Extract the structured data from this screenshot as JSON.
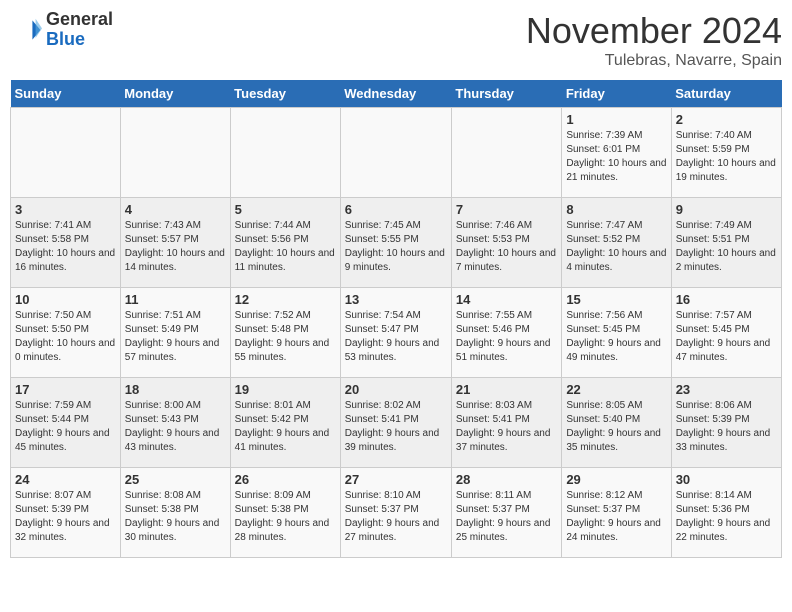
{
  "header": {
    "logo_general": "General",
    "logo_blue": "Blue",
    "month": "November 2024",
    "location": "Tulebras, Navarre, Spain"
  },
  "calendar": {
    "days_of_week": [
      "Sunday",
      "Monday",
      "Tuesday",
      "Wednesday",
      "Thursday",
      "Friday",
      "Saturday"
    ],
    "weeks": [
      [
        {
          "day": "",
          "info": ""
        },
        {
          "day": "",
          "info": ""
        },
        {
          "day": "",
          "info": ""
        },
        {
          "day": "",
          "info": ""
        },
        {
          "day": "",
          "info": ""
        },
        {
          "day": "1",
          "info": "Sunrise: 7:39 AM\nSunset: 6:01 PM\nDaylight: 10 hours and 21 minutes."
        },
        {
          "day": "2",
          "info": "Sunrise: 7:40 AM\nSunset: 5:59 PM\nDaylight: 10 hours and 19 minutes."
        }
      ],
      [
        {
          "day": "3",
          "info": "Sunrise: 7:41 AM\nSunset: 5:58 PM\nDaylight: 10 hours and 16 minutes."
        },
        {
          "day": "4",
          "info": "Sunrise: 7:43 AM\nSunset: 5:57 PM\nDaylight: 10 hours and 14 minutes."
        },
        {
          "day": "5",
          "info": "Sunrise: 7:44 AM\nSunset: 5:56 PM\nDaylight: 10 hours and 11 minutes."
        },
        {
          "day": "6",
          "info": "Sunrise: 7:45 AM\nSunset: 5:55 PM\nDaylight: 10 hours and 9 minutes."
        },
        {
          "day": "7",
          "info": "Sunrise: 7:46 AM\nSunset: 5:53 PM\nDaylight: 10 hours and 7 minutes."
        },
        {
          "day": "8",
          "info": "Sunrise: 7:47 AM\nSunset: 5:52 PM\nDaylight: 10 hours and 4 minutes."
        },
        {
          "day": "9",
          "info": "Sunrise: 7:49 AM\nSunset: 5:51 PM\nDaylight: 10 hours and 2 minutes."
        }
      ],
      [
        {
          "day": "10",
          "info": "Sunrise: 7:50 AM\nSunset: 5:50 PM\nDaylight: 10 hours and 0 minutes."
        },
        {
          "day": "11",
          "info": "Sunrise: 7:51 AM\nSunset: 5:49 PM\nDaylight: 9 hours and 57 minutes."
        },
        {
          "day": "12",
          "info": "Sunrise: 7:52 AM\nSunset: 5:48 PM\nDaylight: 9 hours and 55 minutes."
        },
        {
          "day": "13",
          "info": "Sunrise: 7:54 AM\nSunset: 5:47 PM\nDaylight: 9 hours and 53 minutes."
        },
        {
          "day": "14",
          "info": "Sunrise: 7:55 AM\nSunset: 5:46 PM\nDaylight: 9 hours and 51 minutes."
        },
        {
          "day": "15",
          "info": "Sunrise: 7:56 AM\nSunset: 5:45 PM\nDaylight: 9 hours and 49 minutes."
        },
        {
          "day": "16",
          "info": "Sunrise: 7:57 AM\nSunset: 5:45 PM\nDaylight: 9 hours and 47 minutes."
        }
      ],
      [
        {
          "day": "17",
          "info": "Sunrise: 7:59 AM\nSunset: 5:44 PM\nDaylight: 9 hours and 45 minutes."
        },
        {
          "day": "18",
          "info": "Sunrise: 8:00 AM\nSunset: 5:43 PM\nDaylight: 9 hours and 43 minutes."
        },
        {
          "day": "19",
          "info": "Sunrise: 8:01 AM\nSunset: 5:42 PM\nDaylight: 9 hours and 41 minutes."
        },
        {
          "day": "20",
          "info": "Sunrise: 8:02 AM\nSunset: 5:41 PM\nDaylight: 9 hours and 39 minutes."
        },
        {
          "day": "21",
          "info": "Sunrise: 8:03 AM\nSunset: 5:41 PM\nDaylight: 9 hours and 37 minutes."
        },
        {
          "day": "22",
          "info": "Sunrise: 8:05 AM\nSunset: 5:40 PM\nDaylight: 9 hours and 35 minutes."
        },
        {
          "day": "23",
          "info": "Sunrise: 8:06 AM\nSunset: 5:39 PM\nDaylight: 9 hours and 33 minutes."
        }
      ],
      [
        {
          "day": "24",
          "info": "Sunrise: 8:07 AM\nSunset: 5:39 PM\nDaylight: 9 hours and 32 minutes."
        },
        {
          "day": "25",
          "info": "Sunrise: 8:08 AM\nSunset: 5:38 PM\nDaylight: 9 hours and 30 minutes."
        },
        {
          "day": "26",
          "info": "Sunrise: 8:09 AM\nSunset: 5:38 PM\nDaylight: 9 hours and 28 minutes."
        },
        {
          "day": "27",
          "info": "Sunrise: 8:10 AM\nSunset: 5:37 PM\nDaylight: 9 hours and 27 minutes."
        },
        {
          "day": "28",
          "info": "Sunrise: 8:11 AM\nSunset: 5:37 PM\nDaylight: 9 hours and 25 minutes."
        },
        {
          "day": "29",
          "info": "Sunrise: 8:12 AM\nSunset: 5:37 PM\nDaylight: 9 hours and 24 minutes."
        },
        {
          "day": "30",
          "info": "Sunrise: 8:14 AM\nSunset: 5:36 PM\nDaylight: 9 hours and 22 minutes."
        }
      ]
    ]
  }
}
